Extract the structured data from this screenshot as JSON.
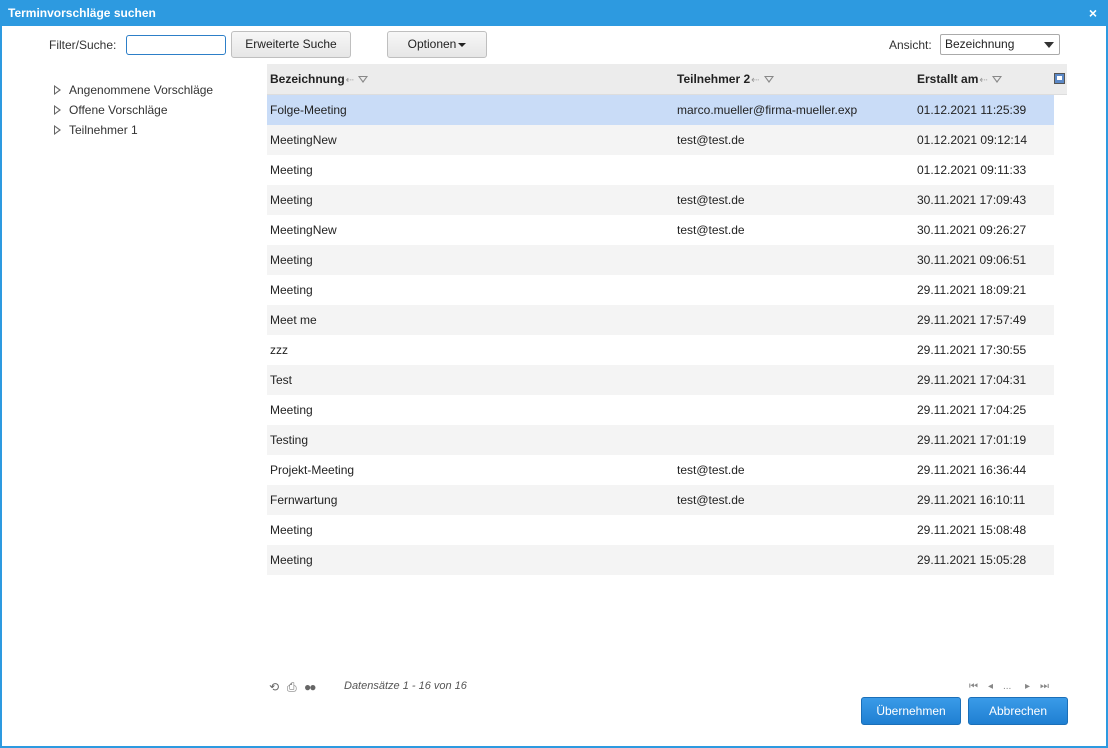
{
  "window": {
    "title": "Terminvorschläge suchen",
    "close_label": "×"
  },
  "toolbar": {
    "filter_label": "Filter/Suche:",
    "search_value": "",
    "advanced_search_label": "Erweiterte Suche",
    "options_label": "Optionen",
    "view_label": "Ansicht:",
    "view_selected": "Bezeichnung"
  },
  "tree": {
    "items": [
      {
        "label": "Angenommene Vorschläge"
      },
      {
        "label": "Offene Vorschläge"
      },
      {
        "label": "Teilnehmer 1"
      }
    ]
  },
  "grid": {
    "columns": [
      "Bezeichnung",
      "Teilnehmer 2",
      "Erstallt am"
    ],
    "rows": [
      [
        "Folge-Meeting",
        "marco.mueller@firma-mueller.exp",
        "01.12.2021 11:25:39"
      ],
      [
        "MeetingNew",
        "test@test.de",
        "01.12.2021 09:12:14"
      ],
      [
        "Meeting",
        "",
        "01.12.2021 09:11:33"
      ],
      [
        "Meeting",
        "test@test.de",
        "30.11.2021 17:09:43"
      ],
      [
        "MeetingNew",
        "test@test.de",
        "30.11.2021 09:26:27"
      ],
      [
        "Meeting",
        "",
        "30.11.2021 09:06:51"
      ],
      [
        "Meeting",
        "",
        "29.11.2021 18:09:21"
      ],
      [
        "Meet me",
        "",
        "29.11.2021 17:57:49"
      ],
      [
        "zzz",
        "",
        "29.11.2021 17:30:55"
      ],
      [
        "Test",
        "",
        "29.11.2021 17:04:31"
      ],
      [
        "Meeting",
        "",
        "29.11.2021 17:04:25"
      ],
      [
        "Testing",
        "",
        "29.11.2021 17:01:19"
      ],
      [
        "Projekt-Meeting",
        "test@test.de",
        "29.11.2021 16:36:44"
      ],
      [
        "Fernwartung",
        "test@test.de",
        "29.11.2021 16:10:11"
      ],
      [
        "Meeting",
        "",
        "29.11.2021 15:08:48"
      ],
      [
        "Meeting",
        "",
        "29.11.2021 15:05:28"
      ]
    ],
    "selected_row": 0
  },
  "footer": {
    "records_text": "Datensätze 1 - 16 von 16",
    "pager_ellipsis": "...",
    "ok_label": "Übernehmen",
    "cancel_label": "Abbrechen"
  },
  "icons": [
    "close-icon",
    "expand-triangle-icon",
    "sort-icon",
    "filter-icon",
    "column-chooser-icon",
    "refresh-icon",
    "print-icon",
    "settings-icon",
    "first-page-icon",
    "previous-page-icon",
    "next-page-icon",
    "last-page-icon"
  ],
  "colors": {
    "accent": "#2d9ae0",
    "selected_row": "#c9dcf7",
    "primary_button": "#1f7fd2"
  }
}
